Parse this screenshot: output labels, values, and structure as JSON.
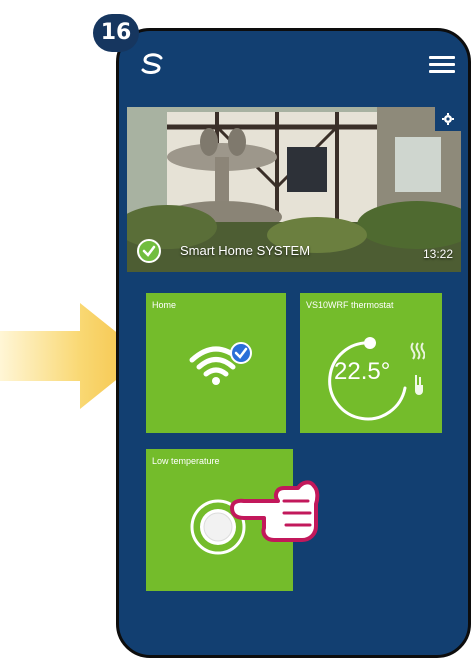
{
  "step_badge": "16",
  "header": {
    "logo_icon": "app-logo-icon",
    "menu_icon": "hamburger-menu-icon"
  },
  "banner": {
    "title": "Smart Home SYSTEM",
    "time": "13:22",
    "status_icon": "check-circle-icon",
    "settings_icon": "gear-icon"
  },
  "tiles": [
    {
      "label": "Home",
      "icon": "wifi-connected-icon"
    },
    {
      "label": "VS10WRF thermostat",
      "value": "22.5°",
      "icon": "thermostat-dial-icon"
    },
    {
      "label": "Low temperature",
      "icon": "scene-button-icon"
    }
  ],
  "colors": {
    "background": "#123f71",
    "tile": "#74bc2b",
    "accent_check": "#2a6fd8",
    "arrow": "#f5c64a"
  }
}
